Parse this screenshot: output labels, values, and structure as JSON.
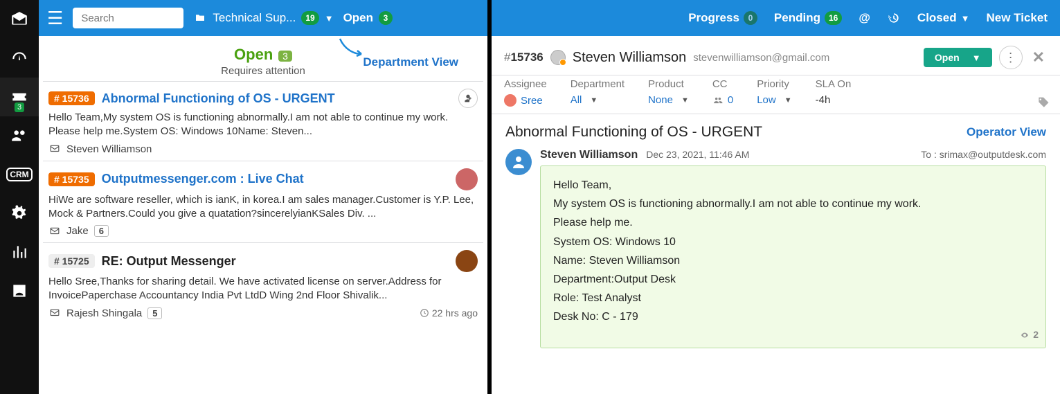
{
  "sidebar_badge": "3",
  "search_placeholder": "Search",
  "folder_label": "Technical Sup...",
  "folder_count": "19",
  "status_filter": "Open",
  "status_filter_count": "3",
  "header_status": "Open",
  "header_status_count": "3",
  "header_sub": "Requires attention",
  "dept_view": "Department View",
  "tickets": [
    {
      "id": "# 15736",
      "id_style": "orange",
      "subject": "Abnormal Functioning of OS - URGENT",
      "subject_style": "link",
      "preview": "Hello Team,My system OS is functioning abnormally.I am not able to continue my work. Please help me.System OS: Windows 10Name: Steven...",
      "from": "Steven Williamson",
      "extra_type": "addperson",
      "reply_count": "",
      "time": ""
    },
    {
      "id": "# 15735",
      "id_style": "orange",
      "subject": "Outputmessenger.com : Live Chat",
      "subject_style": "link",
      "preview": "HiWe are software reseller, which is ianK, in korea.I am sales manager.Customer is Y.P. Lee, Mock & Partners.Could you give a quatation?sincerelyianKSales Div. ...",
      "from": "Jake",
      "extra_type": "avatar1",
      "reply_count": "6",
      "time": ""
    },
    {
      "id": "# 15725",
      "id_style": "grey",
      "subject": "RE: Output Messenger",
      "subject_style": "black",
      "preview": "Hello Sree,Thanks for sharing detail. We have activated license on server.Address for InvoicePaperchase Accountancy India Pvt LtdD Wing 2nd Floor Shivalik...",
      "from": "Rajesh Shingala",
      "extra_type": "avatar2",
      "reply_count": "5",
      "time": "22 hrs ago"
    }
  ],
  "top_right": {
    "progress": "Progress",
    "progress_n": "0",
    "pending": "Pending",
    "pending_n": "16",
    "closed": "Closed",
    "new": "New Ticket"
  },
  "detail": {
    "num": "15736",
    "customer": "Steven Williamson",
    "email": "stevenwilliamson@gmail.com",
    "status_btn": "Open",
    "props": {
      "assignee_l": "Assignee",
      "assignee_v": "Sree",
      "dept_l": "Department",
      "dept_v": "All",
      "product_l": "Product",
      "product_v": "None",
      "cc_l": "CC",
      "cc_v": "0",
      "prio_l": "Priority",
      "prio_v": "Low",
      "sla_l": "SLA On",
      "sla_v": "-4h"
    },
    "subject": "Abnormal Functioning of OS - URGENT",
    "operator_view": "Operator View",
    "msg": {
      "from": "Steven Williamson",
      "date": "Dec 23, 2021, 11:46 AM",
      "to": "To : srimax@outputdesk.com",
      "lines": [
        "Hello Team,",
        "My system OS is functioning abnormally.I am not able to continue my work.",
        "Please help me.",
        "System OS: Windows 10",
        "Name: Steven Williamson",
        "Department:Output Desk",
        "Role: Test Analyst",
        "Desk No: C - 179"
      ],
      "views": "2"
    }
  }
}
